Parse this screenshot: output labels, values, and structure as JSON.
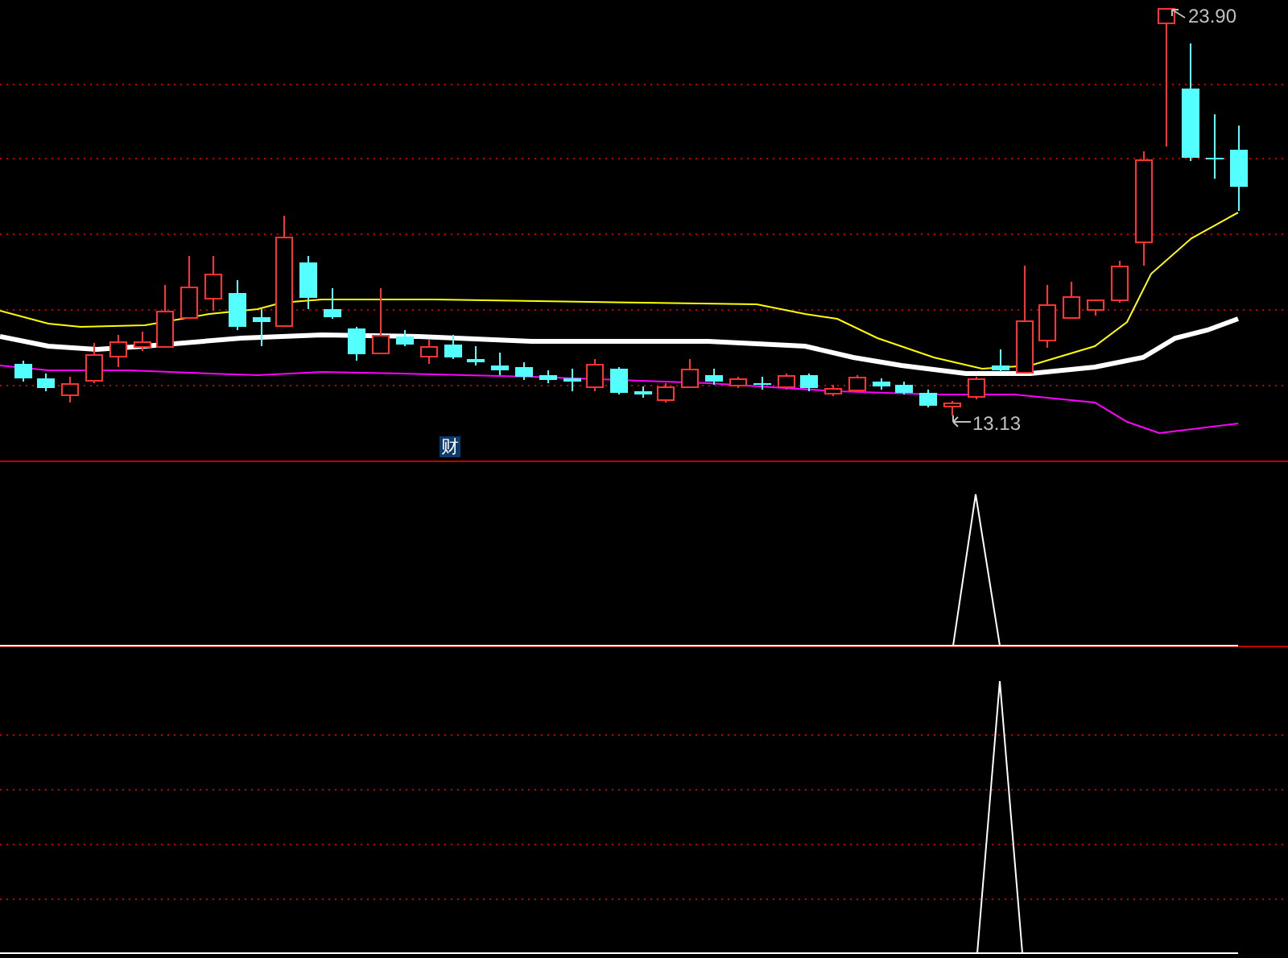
{
  "price_chart": {
    "high_label": "23.90",
    "low_label": "13.13",
    "marker": "财"
  }
}
